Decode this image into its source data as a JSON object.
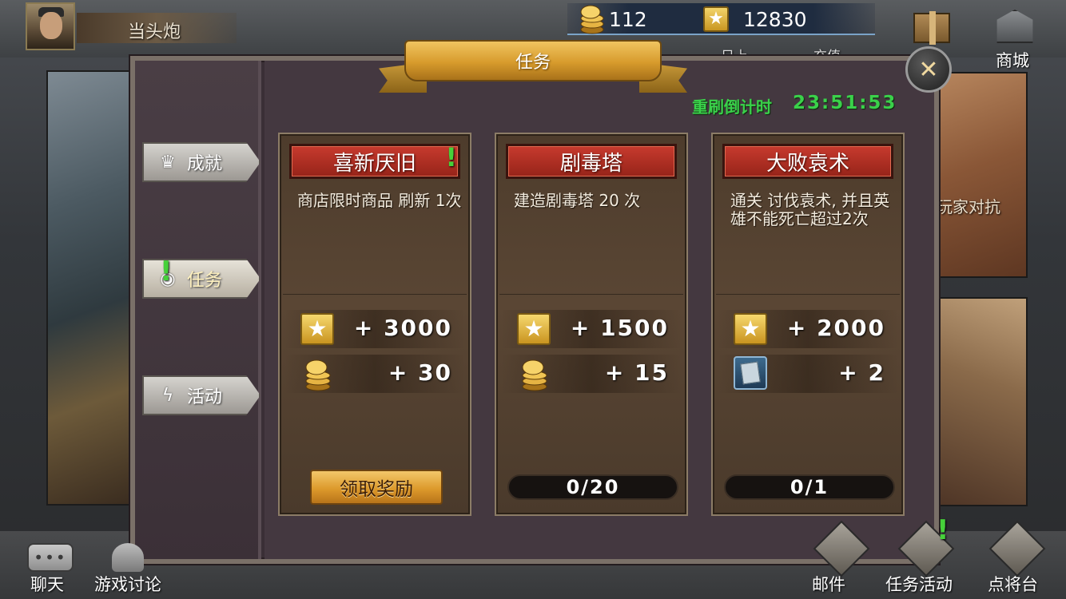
{
  "player": {
    "name": "当头炮"
  },
  "currency": {
    "coins": "112",
    "stars": "12830"
  },
  "top_nav": {
    "shop_label": "商城",
    "hidden_label_1": "日上",
    "hidden_label_2": "充值"
  },
  "panel": {
    "title": "任务",
    "refresh_label": "重刷倒计时",
    "refresh_countdown": "23:51:53",
    "close_icon": "close-icon"
  },
  "tabs": [
    {
      "label": "成就",
      "icon": "crown-icon"
    },
    {
      "label": "任务",
      "icon": "quest-icon",
      "active": true,
      "alert": "!"
    },
    {
      "label": "活动",
      "icon": "lightning-icon"
    }
  ],
  "quests": [
    {
      "title": "喜新厌旧",
      "alert": "!",
      "description": "商店限时商品 刷新 1次",
      "rewards": [
        {
          "icon": "star-icon",
          "value": "+ 3000"
        },
        {
          "icon": "coin-stack-icon",
          "value": "+ 30"
        }
      ],
      "action_label": "领取奖励"
    },
    {
      "title": "剧毒塔",
      "description": "建造剧毒塔 20 次",
      "rewards": [
        {
          "icon": "star-icon",
          "value": "+ 1500"
        },
        {
          "icon": "coin-stack-icon",
          "value": "+ 15"
        }
      ],
      "progress": "0/20",
      "progress_fraction": 0
    },
    {
      "title": "大败袁术",
      "description": "通关 讨伐袁术, 并且英雄不能死亡超过2次",
      "rewards": [
        {
          "icon": "star-icon",
          "value": "+ 2000"
        },
        {
          "icon": "card-icon",
          "value": "+ 2"
        }
      ],
      "progress": "0/1",
      "progress_fraction": 0
    }
  ],
  "background": {
    "side_label": "玩家对抗"
  },
  "bottom_nav": {
    "chat": "聊天",
    "discussion": "游戏讨论",
    "mail": "邮件",
    "quest_activity": "任务活动",
    "quest_alert": "!",
    "general_stage": "点将台"
  },
  "colors": {
    "accent_green": "#3ad14a",
    "title_red": "#c73a2e",
    "gold": "#dd9a2c"
  }
}
